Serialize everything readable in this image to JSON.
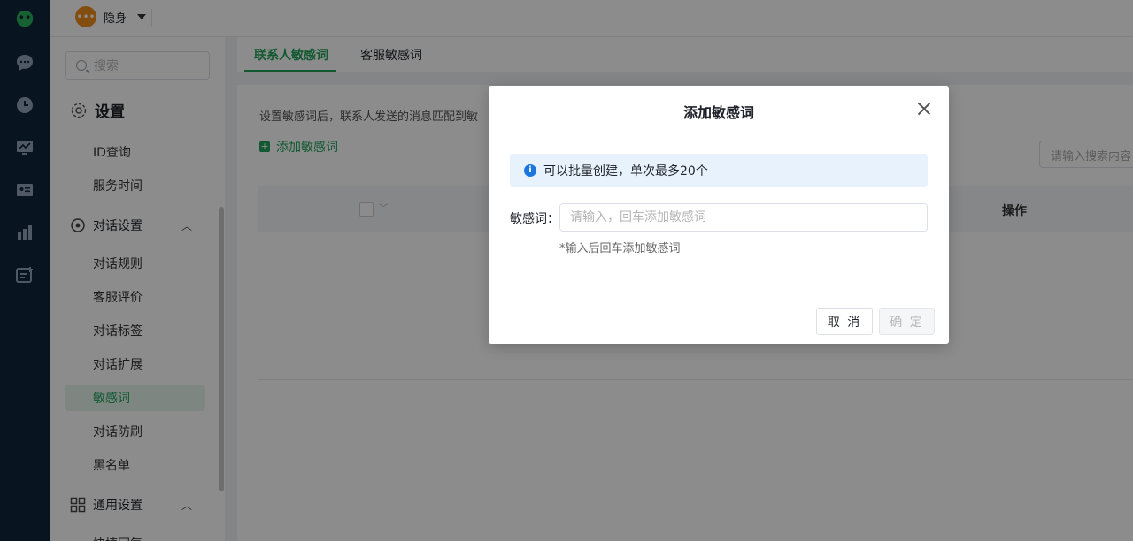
{
  "topbar": {
    "status_label": "隐身"
  },
  "sidebar": {
    "search_placeholder": "搜索",
    "settings_title": "设置",
    "items_top": [
      "ID查询",
      "服务时间"
    ],
    "conversation_group": "对话设置",
    "conversation_items": [
      "对话规则",
      "客服评价",
      "对话标签",
      "对话扩展",
      "敏感词",
      "对话防刷",
      "黑名单"
    ],
    "active_item": "敏感词",
    "general_group": "通用设置",
    "general_partial": "快捷回复"
  },
  "main": {
    "tabs": [
      "联系人敏感词",
      "客服敏感词"
    ],
    "description": "设置敏感词后，联系人发送的消息匹配到敏",
    "add_link": "添加敏感词",
    "search_placeholder": "请输入搜索内容",
    "table_op_header": "操作"
  },
  "modal": {
    "title": "添加敏感词",
    "tip": "可以批量创建，单次最多20个",
    "field_label": "敏感词：",
    "field_value": "",
    "field_placeholder": "请输入，回车添加敏感词",
    "hint": "*输入后回车添加敏感词",
    "cancel_label": "取 消",
    "ok_label": "确 定"
  },
  "colors": {
    "accent": "#22a35a",
    "rail": "#10263a",
    "info": "#1c76e0"
  },
  "icons": [
    "app-logo-icon",
    "chat-icon",
    "history-icon",
    "monitor-icon",
    "contact-card-icon",
    "stats-icon",
    "ticket-icon",
    "settings-gear-icon",
    "dialog-icon",
    "grid-icon",
    "close-icon",
    "info-icon",
    "search-icon"
  ]
}
